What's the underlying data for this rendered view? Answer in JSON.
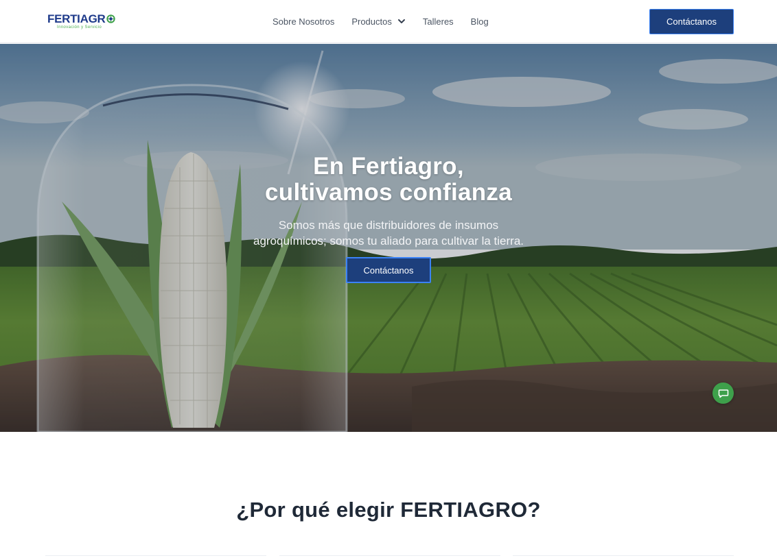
{
  "brand": {
    "name_part1": "FERTI",
    "name_part2": "AGR",
    "tagline": "Innovación y Servicio",
    "colors": {
      "primary": "#1d3f7c",
      "accent": "#3b82f6",
      "green": "#3ea04b"
    }
  },
  "nav": {
    "items": [
      {
        "label": "Sobre Nosotros"
      },
      {
        "label": "Productos",
        "icon": "chevron-down-icon"
      },
      {
        "label": "Talleres"
      },
      {
        "label": "Blog"
      }
    ],
    "cta_label": "Contáctanos"
  },
  "hero": {
    "title_line1": "En Fertiagro,",
    "title_line2": "cultivamos confianza",
    "subtitle_line1": "Somos más que distribuidores de insumos",
    "subtitle_line2": "agroquímicos; somos tu aliado para cultivar la tierra.",
    "cta_label": "Contáctanos",
    "chat_icon": "chat-bubble-icon"
  },
  "section": {
    "title": "¿Por qué elegir FERTIAGRO?"
  }
}
